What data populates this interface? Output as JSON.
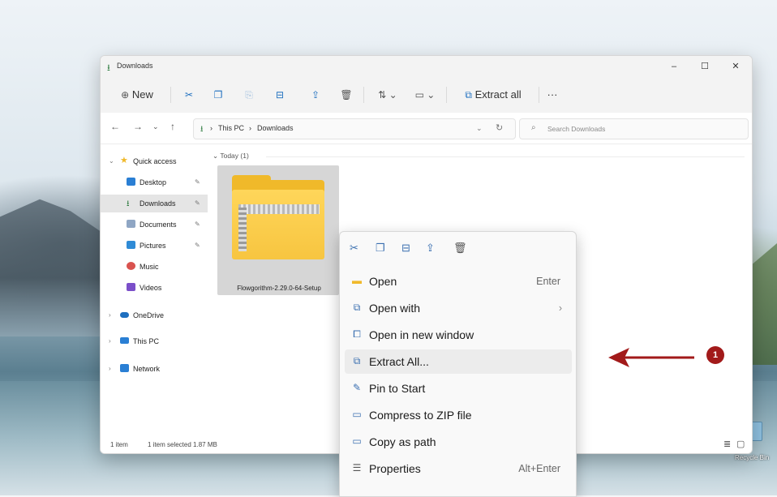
{
  "window": {
    "title": "Downloads",
    "min": "–",
    "max": "☐",
    "close": "✕"
  },
  "toolbar": {
    "new_label": "New",
    "extract_all_label": "Extract all",
    "more": "···",
    "icons": [
      "cut-icon",
      "copy-icon",
      "paste-icon",
      "rename-icon",
      "share-icon",
      "delete-icon",
      "sort-icon",
      "view-icon",
      "extract-icon"
    ]
  },
  "nav": {
    "back": "←",
    "forward": "→",
    "recent": "⌄",
    "up": "↑",
    "breadcrumbs": [
      "This PC",
      "Downloads"
    ],
    "sep": "›",
    "search_placeholder": "Search Downloads"
  },
  "sidebar": {
    "items": [
      {
        "label": "Quick access"
      },
      {
        "label": "Desktop"
      },
      {
        "label": "Downloads"
      },
      {
        "label": "Documents"
      },
      {
        "label": "Pictures"
      },
      {
        "label": "Music"
      },
      {
        "label": "Videos"
      },
      {
        "label": "OneDrive"
      },
      {
        "label": "This PC"
      },
      {
        "label": "Network"
      }
    ]
  },
  "content": {
    "group_header": "Today (1)",
    "file_name": "Flowgorithm-2.29.0-64-Setup"
  },
  "status": {
    "item_count": "1 item",
    "selection": "1 item selected  1.87 MB"
  },
  "context_menu": {
    "items": [
      {
        "label": "Open",
        "shortcut": "Enter",
        "icon": "folder-icon"
      },
      {
        "label": "Open with",
        "shortcut": "›",
        "icon": "open-with-icon"
      },
      {
        "label": "Open in new window",
        "shortcut": "",
        "icon": "new-window-icon"
      },
      {
        "label": "Extract All...",
        "shortcut": "",
        "icon": "extract-icon"
      },
      {
        "label": "Pin to Start",
        "shortcut": "",
        "icon": "pin-icon"
      },
      {
        "label": "Compress to ZIP file",
        "shortcut": "",
        "icon": "zip-icon"
      },
      {
        "label": "Copy as path",
        "shortcut": "",
        "icon": "copy-path-icon"
      },
      {
        "label": "Properties",
        "shortcut": "Alt+Enter",
        "icon": "properties-icon"
      }
    ]
  },
  "annotation": {
    "badge": "1",
    "color": "#a21a1a"
  },
  "desktop": {
    "recycle_bin_label": "Recycle Bin"
  },
  "colors": {
    "accent": "#1e6fbf",
    "folder": "#f0b92a",
    "selection": "#d6d6d6"
  }
}
